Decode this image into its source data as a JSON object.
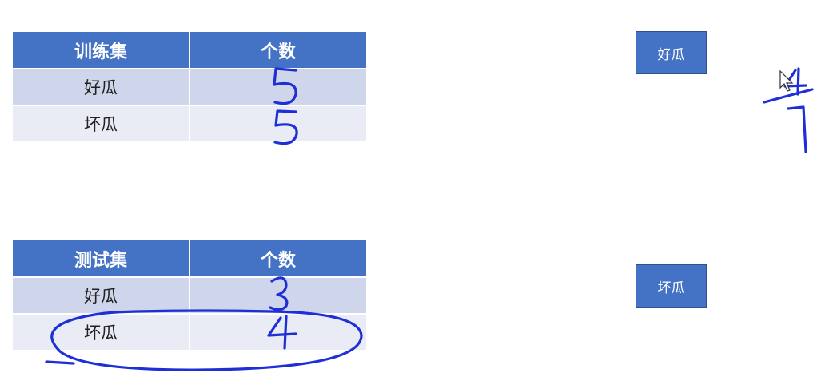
{
  "train_table": {
    "headers": [
      "训练集",
      "个数"
    ],
    "rows": [
      {
        "label": "好瓜",
        "count": "5"
      },
      {
        "label": "坏瓜",
        "count": "5"
      }
    ]
  },
  "test_table": {
    "headers": [
      "测试集",
      "个数"
    ],
    "rows": [
      {
        "label": "好瓜",
        "count": "3"
      },
      {
        "label": "坏瓜",
        "count": "4"
      }
    ]
  },
  "boxes": {
    "good_label": "好瓜",
    "bad_label": "坏瓜"
  },
  "handwritten_fraction": {
    "numerator": "4",
    "denominator": "7"
  },
  "colors": {
    "header_blue": "#4472c4",
    "row_dark": "#cfd5ea",
    "row_light": "#e9ebf5",
    "ink_blue": "#1f2fd6"
  }
}
